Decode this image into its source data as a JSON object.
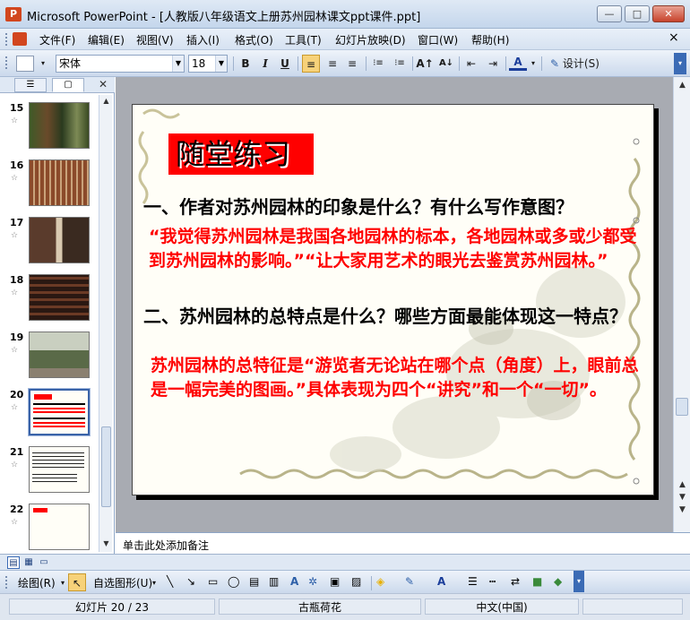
{
  "window": {
    "app_name": "Microsoft PowerPoint",
    "title": "Microsoft PowerPoint - [人教版八年级语文上册苏州园林课文ppt课件.ppt]",
    "minimize": "—",
    "maximize": "□",
    "close": "✕"
  },
  "menu": {
    "items": [
      "文件(F)",
      "编辑(E)",
      "视图(V)",
      "插入(I)",
      "格式(O)",
      "工具(T)",
      "幻灯片放映(D)",
      "窗口(W)",
      "帮助(H)"
    ],
    "close_glyph": "×"
  },
  "toolbar": {
    "font_name": "宋体",
    "font_size": "18",
    "bold": "B",
    "italic": "I",
    "underline": "U",
    "align_left": "≡",
    "align_center": "≡",
    "align_right": "≡",
    "numbering": "⁝≡",
    "bullets": "⁝≡",
    "grow_font": "A↑",
    "shrink_font": "A↓",
    "decrease_indent": "⇤",
    "increase_indent": "⇥",
    "font_color": "A",
    "design_label": "设计(S)"
  },
  "thumbnails": [
    {
      "number": "15",
      "star": "☆",
      "bg": "#5b4a32"
    },
    {
      "number": "16",
      "star": "☆",
      "bg": "#6b3a25"
    },
    {
      "number": "17",
      "star": "☆",
      "bg": "#4a3325"
    },
    {
      "number": "18",
      "star": "☆",
      "bg": "#3d2418"
    },
    {
      "number": "19",
      "star": "☆",
      "bg": "#8a8f80"
    },
    {
      "number": "20",
      "star": "☆",
      "bg": "#fffef7"
    },
    {
      "number": "21",
      "star": "☆",
      "bg": "#fffef7"
    },
    {
      "number": "22",
      "star": "☆",
      "bg": "#fffef7"
    }
  ],
  "slide": {
    "heading": "随堂练习",
    "question1": "一、作者对苏州园林的印象是什么？有什么写作意图？",
    "answer1": "“我觉得苏州园林是我国各地园林的标本，各地园林或多或少都受到苏州园林的影响。”“让大家用艺术的眼光去鉴赏苏州园林。”",
    "question2": "二、苏州园林的总特点是什么？哪些方面最能体现这一特点？",
    "answer2": "苏州园林的总特征是“游览者无论站在哪个点（角度）上，眼前总是一幅完美的图画。”具体表现为四个“讲究”和一个“一切”。",
    "colors": {
      "heading_bg": "#ff0000",
      "answer": "#ff0000",
      "question": "#000000"
    }
  },
  "notes": {
    "placeholder": "单击此处添加备注"
  },
  "drawing": {
    "draw_label": "绘图(R)",
    "autoshapes_label": "自选图形(U)"
  },
  "status": {
    "slide_info": "幻灯片 20 / 23",
    "template": "古瓶荷花",
    "language": "中文(中国)"
  }
}
